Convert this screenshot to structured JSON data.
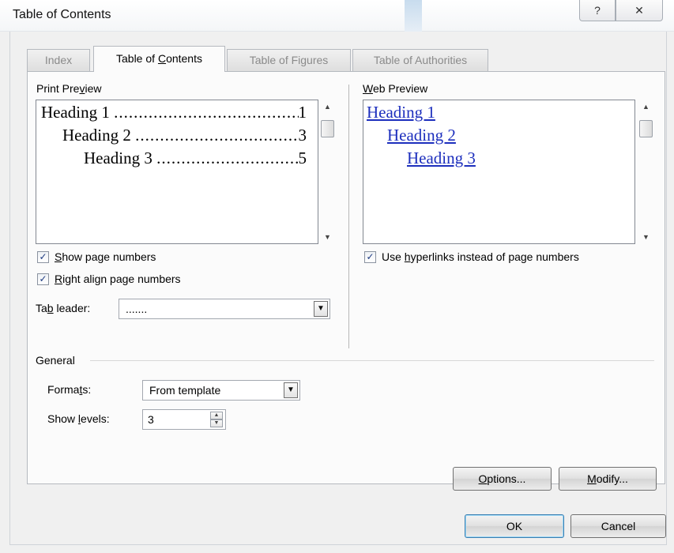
{
  "window": {
    "title": "Table of Contents",
    "help_glyph": "?",
    "close_glyph": "✕"
  },
  "tabs": [
    {
      "label": "Index",
      "active": false
    },
    {
      "label": "Table of Contents",
      "active": true
    },
    {
      "label": "Table of Figures",
      "active": false
    },
    {
      "label": "Table of Authorities",
      "active": false
    }
  ],
  "print_preview": {
    "label": "Print Preview",
    "lines": [
      {
        "text": "Heading 1",
        "dots": "....................................................",
        "page": "1"
      },
      {
        "text": "Heading 2",
        "dots": "....................................................",
        "page": "3"
      },
      {
        "text": "Heading 3",
        "dots": "....................................................",
        "page": "5"
      }
    ]
  },
  "web_preview": {
    "label": "Web Preview",
    "links": [
      "Heading 1",
      "Heading 2",
      "Heading 3"
    ]
  },
  "options": {
    "show_page_numbers": {
      "label": "Show page numbers",
      "checked": true
    },
    "right_align": {
      "label": "Right align page numbers",
      "checked": true
    },
    "use_hyperlinks": {
      "label": "Use hyperlinks instead of page numbers",
      "checked": true
    },
    "tab_leader_label": "Tab leader:",
    "tab_leader_value": "......."
  },
  "general": {
    "heading": "General",
    "formats_label": "Formats:",
    "formats_value": "From template",
    "levels_label": "Show levels:",
    "levels_value": "3"
  },
  "buttons": {
    "options": "Options...",
    "modify": "Modify...",
    "ok": "OK",
    "cancel": "Cancel"
  },
  "icons": {
    "check": "✓",
    "dropdown": "▼",
    "scroll_up": "▲",
    "scroll_down": "▼",
    "spin_up": "▲",
    "spin_down": "▼"
  },
  "colors": {
    "link": "#1d2fbd",
    "dialog_bg": "#f0f0f0",
    "panel_bg": "#fbfbfb"
  }
}
